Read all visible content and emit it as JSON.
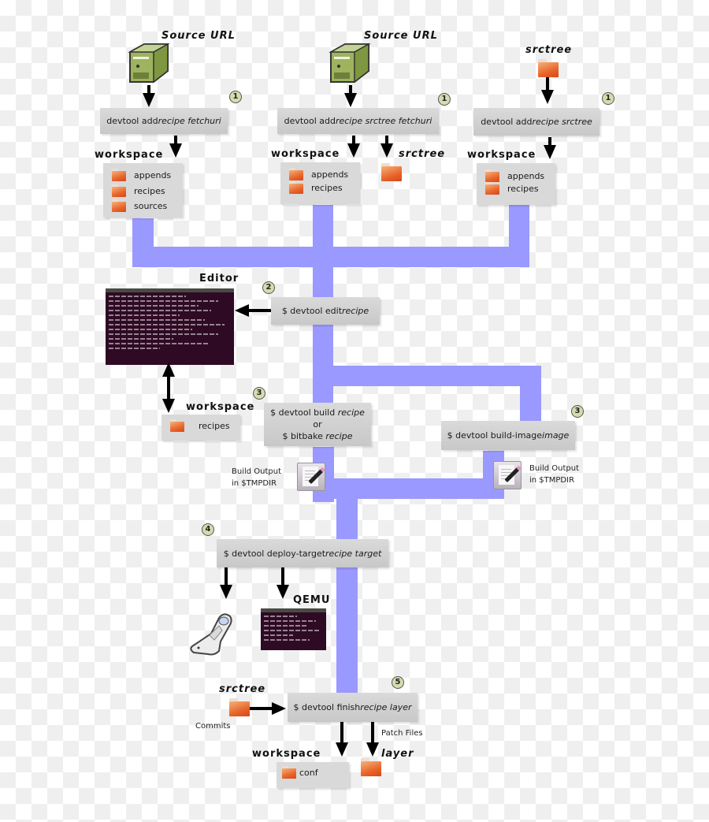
{
  "top_sources": [
    {
      "label": "Source URL",
      "icon": "server-icon"
    },
    {
      "label": "Source URL",
      "icon": "server-icon"
    },
    {
      "label": "srctree",
      "icon": "folder-icon"
    }
  ],
  "step1_commands": [
    {
      "prefix": "devtool add ",
      "italic": "recipe fetchuri",
      "step": "1"
    },
    {
      "prefix": "devtool add ",
      "italic": "recipe srctree fetchuri",
      "step": "1"
    },
    {
      "prefix": "devtool add ",
      "italic": "recipe srctree",
      "step": "1"
    }
  ],
  "workspaces_top": [
    {
      "label": "workspace",
      "items": [
        "appends",
        "recipes",
        "sources"
      ]
    },
    {
      "label": "workspace",
      "items": [
        "appends",
        "recipes"
      ]
    },
    {
      "label": "workspace",
      "items": [
        "appends",
        "recipes"
      ]
    }
  ],
  "srctree_output_label": "srctree",
  "editor": {
    "label": "Editor",
    "step": "2",
    "command_prefix": "$ devtool edit ",
    "command_italic": "recipe"
  },
  "workspace_mid": {
    "label": "workspace",
    "items": [
      "recipes"
    ]
  },
  "build": {
    "step": "3",
    "line1_prefix": "$ devtool build ",
    "line1_italic": "recipe",
    "or": "or",
    "line2_prefix": "$ bitbake ",
    "line2_italic": "recipe"
  },
  "build_image": {
    "step": "3",
    "prefix": "$ devtool build-image ",
    "italic": "image"
  },
  "build_output_left": {
    "line1": "Build Output",
    "line2": "in $TMPDIR"
  },
  "build_output_right": {
    "line1": "Build Output",
    "line2": "in $TMPDIR"
  },
  "deploy": {
    "step": "4",
    "prefix": "$ devtool deploy-target ",
    "italic": "recipe target"
  },
  "qemu_label": "QEMU",
  "finish": {
    "step": "5",
    "prefix": "$ devtool finish ",
    "italic": "recipe layer"
  },
  "srctree_bottom": {
    "label": "srctree",
    "caption": "Commits"
  },
  "patch_files_label": "Patch Files",
  "workspace_bottom": {
    "label": "workspace",
    "items": [
      "conf"
    ]
  },
  "layer_label": "layer",
  "colors": {
    "pipe": "#9999ff",
    "box": "#d9d9d9",
    "badge": "#d4dcae",
    "folder": "#e8652a",
    "terminal": "#2f0a24"
  }
}
